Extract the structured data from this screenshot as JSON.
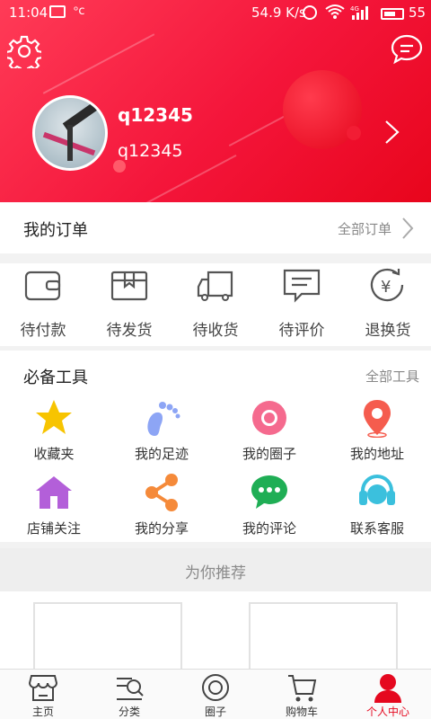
{
  "status_bar": {
    "time": "11:04",
    "net_speed": "54.9 K/s",
    "battery": "55",
    "signal_label": "4G"
  },
  "profile": {
    "username": "q12345",
    "nickname": "q12345"
  },
  "orders": {
    "title": "我的订单",
    "all_label": "全部订单",
    "items": [
      {
        "label": "待付款",
        "icon": "wallet-icon"
      },
      {
        "label": "待发货",
        "icon": "package-icon"
      },
      {
        "label": "待收货",
        "icon": "truck-icon"
      },
      {
        "label": "待评价",
        "icon": "comment-icon"
      },
      {
        "label": "退换货",
        "icon": "refund-icon"
      }
    ]
  },
  "tools": {
    "title": "必备工具",
    "all_label": "全部工具",
    "items": [
      {
        "label": "收藏夹",
        "icon": "star-icon",
        "color": "#f7c400"
      },
      {
        "label": "我的足迹",
        "icon": "footprint-icon",
        "color": "#8da5f5"
      },
      {
        "label": "我的圈子",
        "icon": "circle-icon",
        "color": "#f56a8e"
      },
      {
        "label": "我的地址",
        "icon": "location-pin-icon",
        "color": "#f55c4e"
      },
      {
        "label": "店铺关注",
        "icon": "house-icon",
        "color": "#b35fd9"
      },
      {
        "label": "我的分享",
        "icon": "share-icon",
        "color": "#f58a3a"
      },
      {
        "label": "我的评论",
        "icon": "chat-bubble-icon",
        "color": "#1fae55"
      },
      {
        "label": "联系客服",
        "icon": "headset-icon",
        "color": "#3bc0dd"
      }
    ]
  },
  "recommend": {
    "title": "为你推荐"
  },
  "bottom_nav": {
    "items": [
      {
        "label": "主页",
        "icon": "store-icon"
      },
      {
        "label": "分类",
        "icon": "category-search-icon"
      },
      {
        "label": "圈子",
        "icon": "ring-icon"
      },
      {
        "label": "购物车",
        "icon": "cart-icon"
      },
      {
        "label": "个人中心",
        "icon": "user-icon",
        "active": true
      }
    ]
  },
  "colors": {
    "brand_red": "#e8051c",
    "active_nav": "#e5081f"
  }
}
